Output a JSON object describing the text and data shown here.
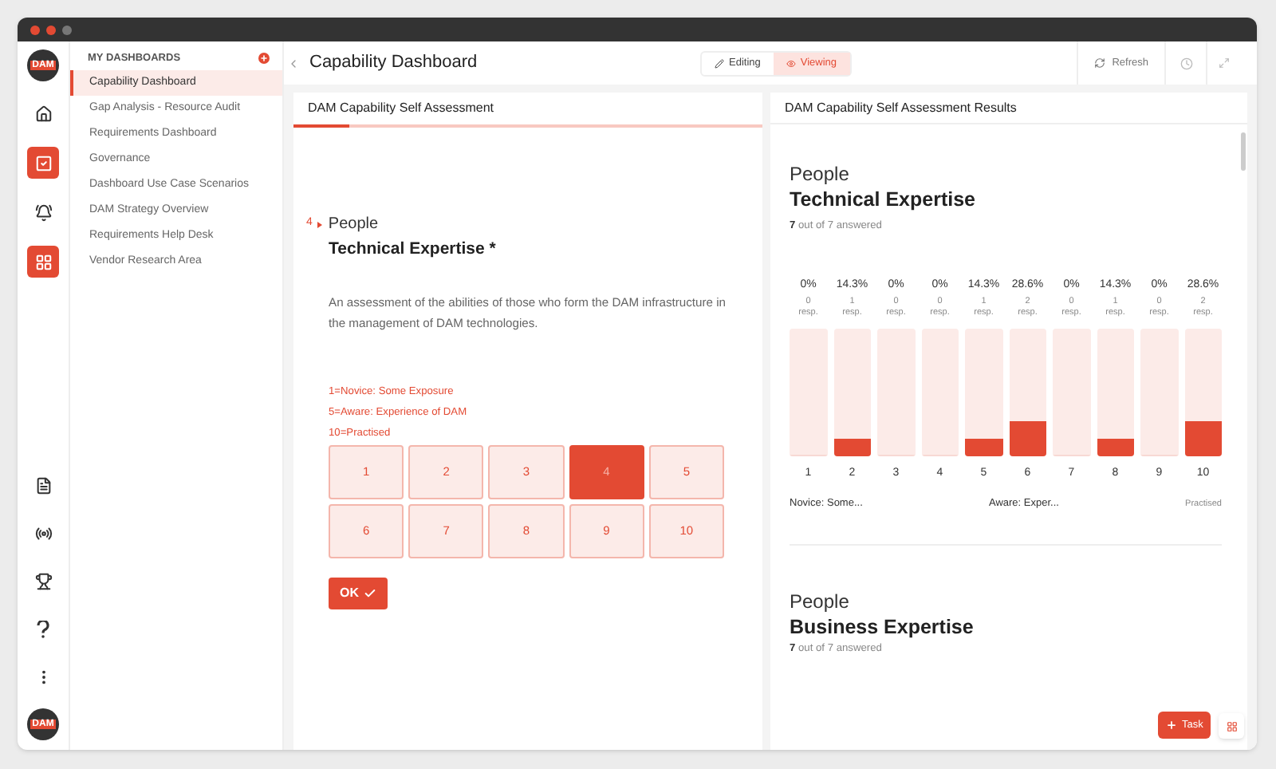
{
  "logo": {
    "text": "DAM"
  },
  "rail": [
    {
      "kind": "home",
      "selected": false
    },
    {
      "kind": "check",
      "selected": true
    },
    {
      "kind": "bell",
      "selected": false
    },
    {
      "kind": "grid",
      "selected": true
    },
    {
      "kind": "file",
      "selected": false
    },
    {
      "kind": "radio",
      "selected": false
    },
    {
      "kind": "trophy",
      "selected": false
    },
    {
      "kind": "help",
      "selected": false
    },
    {
      "kind": "more",
      "selected": false
    }
  ],
  "user": {
    "text": "DAM"
  },
  "sidebar": {
    "title": "MY DASHBOARDS",
    "items": [
      {
        "label": "Capability Dashboard",
        "selected": true
      },
      {
        "label": "Gap Analysis - Resource Audit",
        "selected": false
      },
      {
        "label": "Requirements Dashboard",
        "selected": false
      },
      {
        "label": "Governance",
        "selected": false
      },
      {
        "label": "Dashboard Use Case Scenarios",
        "selected": false
      },
      {
        "label": "DAM Strategy Overview",
        "selected": false
      },
      {
        "label": "Requirements Help Desk",
        "selected": false
      },
      {
        "label": "Vendor Research Area",
        "selected": false
      }
    ]
  },
  "header": {
    "title": "Capability Dashboard",
    "modes": [
      {
        "kind": "edit",
        "label": "Editing",
        "selected": false
      },
      {
        "kind": "view",
        "label": "Viewing",
        "selected": true
      }
    ],
    "refresh": "Refresh"
  },
  "assessment": {
    "title": "DAM Capability Self Assessment",
    "progress": {
      "level": 0.12
    },
    "number": "4",
    "category": "People",
    "question": "Technical Expertise *",
    "description": "An assessment of the abilities of those who form the DAM infrastructure in the management of DAM technologies.",
    "scale": [
      "1=Novice: Some Exposure",
      "5=Aware: Experience of DAM",
      "10=Practised"
    ],
    "options": [
      {
        "label": "1",
        "selected": false
      },
      {
        "label": "2",
        "selected": false
      },
      {
        "label": "3",
        "selected": false
      },
      {
        "label": "4",
        "selected": true
      },
      {
        "label": "5",
        "selected": false
      },
      {
        "label": "6",
        "selected": false
      },
      {
        "label": "7",
        "selected": false
      },
      {
        "label": "8",
        "selected": false
      },
      {
        "label": "9",
        "selected": false
      },
      {
        "label": "10",
        "selected": false
      }
    ],
    "ok": "OK"
  },
  "results": {
    "title": "DAM Capability Self Assessment Results",
    "sections": [
      {
        "category": "People",
        "question": "Technical Expertise",
        "answered_count": "7",
        "answered_text": "out of 7 answered",
        "bars": [
          {
            "percent": "0%",
            "responses": "0",
            "unit": "resp.",
            "level": 0,
            "label": "1"
          },
          {
            "percent": "14.3%",
            "responses": "1",
            "unit": "resp.",
            "level": 0.143,
            "label": "2"
          },
          {
            "percent": "0%",
            "responses": "0",
            "unit": "resp.",
            "level": 0,
            "label": "3"
          },
          {
            "percent": "0%",
            "responses": "0",
            "unit": "resp.",
            "level": 0,
            "label": "4"
          },
          {
            "percent": "14.3%",
            "responses": "1",
            "unit": "resp.",
            "level": 0.143,
            "label": "5"
          },
          {
            "percent": "28.6%",
            "responses": "2",
            "unit": "resp.",
            "level": 0.286,
            "label": "6"
          },
          {
            "percent": "0%",
            "responses": "0",
            "unit": "resp.",
            "level": 0,
            "label": "7"
          },
          {
            "percent": "14.3%",
            "responses": "1",
            "unit": "resp.",
            "level": 0.143,
            "label": "8"
          },
          {
            "percent": "0%",
            "responses": "0",
            "unit": "resp.",
            "level": 0,
            "label": "9"
          },
          {
            "percent": "28.6%",
            "responses": "2",
            "unit": "resp.",
            "level": 0.286,
            "label": "10"
          }
        ],
        "scale_labels": [
          "Novice: Some...",
          "Aware: Exper...",
          "Practised"
        ]
      },
      {
        "category": "People",
        "question": "Business Expertise",
        "answered_count": "7",
        "answered_text": "out of 7 answered"
      }
    ]
  },
  "task_button": "Task"
}
